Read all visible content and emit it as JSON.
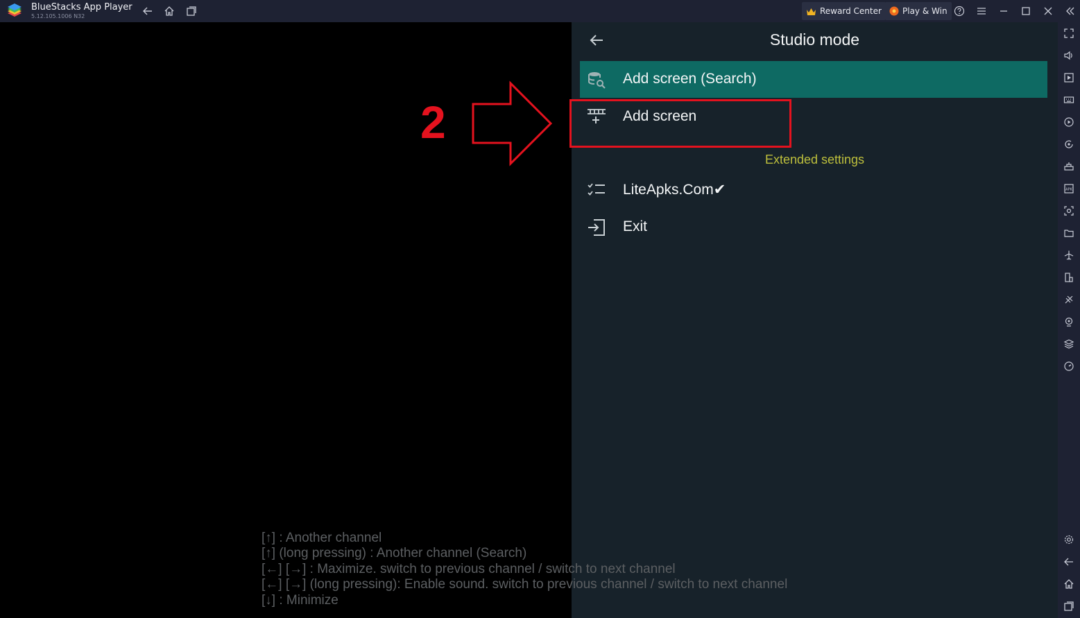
{
  "titlebar": {
    "app_name": "BlueStacks App Player",
    "version": "5.12.105.1006 N32",
    "reward_label": "Reward Center",
    "play_label": "Play & Win"
  },
  "studio": {
    "title": "Studio mode",
    "items": [
      {
        "label": "Add screen (Search)",
        "icon": "database-search-icon",
        "selected": true
      },
      {
        "label": "Add screen",
        "icon": "add-grid-icon"
      },
      {
        "label": "LiteApks.Com✔",
        "icon": "checklist-icon"
      },
      {
        "label": "Exit",
        "icon": "exit-icon"
      }
    ],
    "section_label": "Extended settings"
  },
  "hints": [
    "[↑] : Another channel",
    "[↑] (long pressing) : Another channel (Search)",
    "[←] [→] : Maximize. switch to previous channel / switch to next channel",
    "[←] [→] (long pressing): Enable sound. switch to previous channel  / switch to next channel",
    "[↓] : Minimize"
  ],
  "annotation": {
    "step_number": "2",
    "color": "#e4121e"
  },
  "colors": {
    "titlebar": "#1e2233",
    "panel": "#17222a",
    "selected": "#0e6a63",
    "accent_yellow": "#bdbf3c"
  }
}
